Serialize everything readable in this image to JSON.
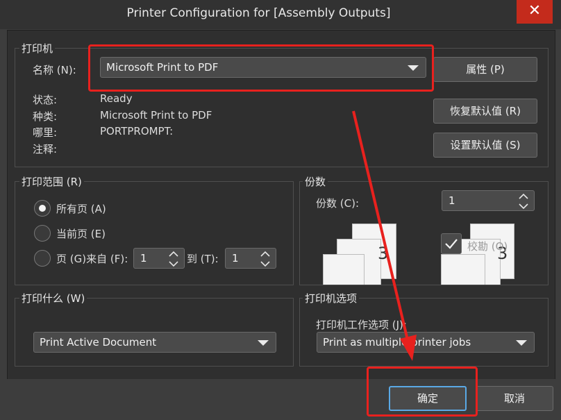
{
  "window": {
    "title": "Printer Configuration for [Assembly Outputs]",
    "close_glyph": "✕"
  },
  "printer_group": {
    "title": "打印机",
    "name_label": "名称 (N):",
    "selected_printer": "Microsoft Print to PDF",
    "properties_button": "属性 (P)",
    "restore_defaults_button": "恢复默认值 (R)",
    "set_defaults_button": "设置默认值 (S)",
    "status_label": "状态:",
    "status_value": "Ready",
    "type_label": "种类:",
    "type_value": "Microsoft Print to PDF",
    "where_label": "哪里:",
    "where_value": "PORTPROMPT:",
    "comment_label": "注释:"
  },
  "print_range_group": {
    "title": "打印范围 (R)",
    "all_pages": "所有页 (A)",
    "current_page": "当前页 (E)",
    "pages_from": "页 (G)来自 (F):",
    "from_value": "1",
    "to_label": "到 (T):",
    "to_value": "1",
    "selected": "all_pages"
  },
  "copies_group": {
    "title": "份数",
    "copies_label": "份数 (C):",
    "copies_value": "1",
    "collate_label": "校勘 (O)",
    "collate_checked": true,
    "preview_digits": [
      "3",
      "3"
    ]
  },
  "print_what_group": {
    "title": "打印什么 (W)",
    "selected": "Print Active Document"
  },
  "printer_options_group": {
    "title": "打印机选项",
    "job_options_label": "打印机工作选项 (J):",
    "selected": "Print as multiple printer jobs"
  },
  "footer": {
    "ok_button": "确定",
    "cancel_button": "取消"
  },
  "colors": {
    "annotation_red": "#e8211e",
    "close_red": "#c42b1c",
    "ok_border": "#5aa9e6"
  }
}
